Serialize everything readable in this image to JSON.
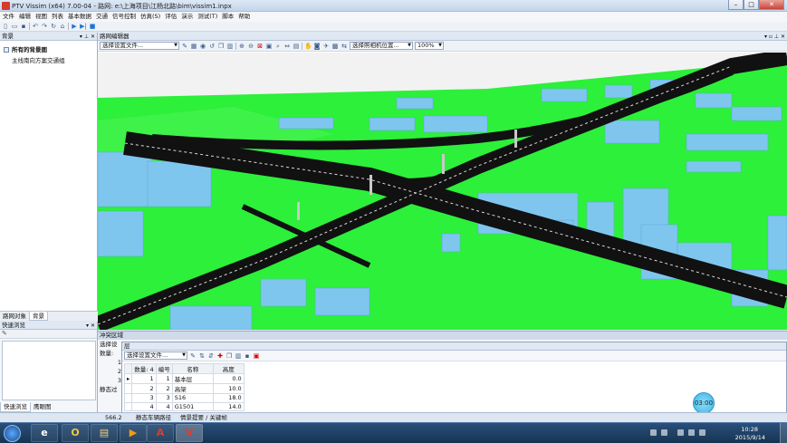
{
  "window": {
    "title": "PTV Vissim (x64) 7.00-04 - 路网: e:\\上海项目\\江杨北路\\bim\\vissim1.inpx",
    "controls": [
      "–",
      "□",
      "✕"
    ]
  },
  "menu": [
    "文件",
    "编辑",
    "视图",
    "列表",
    "基本数据",
    "交通",
    "信号控制",
    "仿真(S)",
    "评估",
    "演示",
    "测试(T)",
    "脚本",
    "帮助"
  ],
  "left_pane": {
    "title": "背景",
    "items": [
      "所有的背景图",
      "主线南向方案交通组"
    ],
    "tabs": [
      "路网对象",
      "背景"
    ],
    "active_tab": "背景"
  },
  "quick_pane": {
    "title": "快速浏览",
    "tabs": [
      "快速浏览",
      "鹰眼图"
    ],
    "active_tab": "快速浏览"
  },
  "network_editor": {
    "title": "路网编辑器",
    "select_layout": "选择设置文件...",
    "camera_select": "选择照相机位置...",
    "zoom": "100%"
  },
  "list_window": {
    "title": "冲突区域",
    "select_layout": "选择设",
    "count_label": "数量:",
    "rows": [
      "1",
      "2",
      "3"
    ],
    "bottom_label": "静态过"
  },
  "layers_window": {
    "title": "层",
    "select_layout": "选择设置文件...",
    "columns": [
      "数量:",
      "编号",
      "名称",
      "高度"
    ],
    "rows": [
      [
        "1",
        "1",
        "基本层",
        "0.0"
      ],
      [
        "2",
        "2",
        "高架",
        "10.0"
      ],
      [
        "3",
        "3",
        "S16",
        "18.0"
      ],
      [
        "4",
        "4",
        "G1501",
        "14.0"
      ]
    ],
    "count": "4"
  },
  "status": {
    "coords": "566.2",
    "tab1": "静态车辆路径",
    "tab2": "情景提要 / 关键帧"
  },
  "sim_clock": "03:00",
  "taskbar": {
    "time": "10:28",
    "date": "2015/9/14"
  }
}
